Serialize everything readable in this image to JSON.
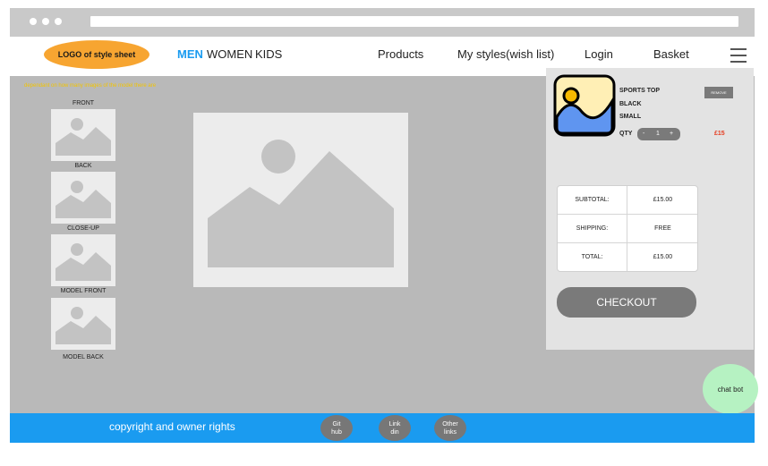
{
  "logo": {
    "text": "LOGO of style sheet"
  },
  "nav": {
    "men": "MEN",
    "women": "WOMEN",
    "kids": "KIDS",
    "products": "Products",
    "wishlist": "My styles(wish list)",
    "login": "Login",
    "basket": "Basket"
  },
  "note": "dependant on how many images of the model there are",
  "thumbnails": [
    "FRONT",
    "BACK",
    "CLOSE-UP",
    "MODEL FRONT",
    "MODEL BACK"
  ],
  "cart": {
    "item": {
      "name": "SPORTS TOP",
      "color": "BLACK",
      "size": "SMALL"
    },
    "remove_label": "REMOVE",
    "qty_label": "QTY",
    "qty_minus": "-",
    "qty_value": "1",
    "qty_plus": "+",
    "price": "£15",
    "summary": [
      {
        "label": "SUBTOTAL:",
        "value": "£15.00"
      },
      {
        "label": "SHIPPING:",
        "value": "FREE"
      },
      {
        "label": "TOTAL:",
        "value": "£15.00"
      }
    ],
    "checkout_label": "CHECKOUT"
  },
  "chatbot_label": "chat bot",
  "footer": {
    "copyright": "copyright and owner rights",
    "links": [
      {
        "line1": "Git",
        "line2": "hub"
      },
      {
        "line1": "Link",
        "line2": "din"
      },
      {
        "line1": "Other",
        "line2": "links"
      }
    ]
  },
  "colors": {
    "accent_blue": "#1a9bf0",
    "logo_orange": "#f7a531",
    "price_red": "#e53c1f",
    "chatbot_green": "#b6f2c2",
    "note_yellow": "#f2c400"
  }
}
